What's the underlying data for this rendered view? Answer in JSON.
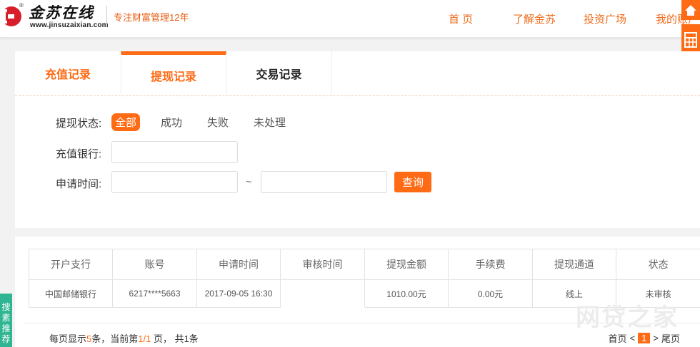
{
  "header": {
    "logo_text": "金苏在线",
    "logo_registered": "®",
    "logo_url": "www.jinsuzaixian.com",
    "slogan": "专注财富管理12年",
    "nav": [
      "首  页",
      "了解金苏",
      "投资广场",
      "我的账户"
    ]
  },
  "tabs": [
    "充值记录",
    "提现记录",
    "交易记录"
  ],
  "active_tab": "提现记录",
  "filters": {
    "status_label": "提现状态:",
    "status_options": [
      "全部",
      "成功",
      "失败",
      "未处理"
    ],
    "status_selected": "全部",
    "bank_label": "充值银行:",
    "bank_value": "",
    "time_label": "申请时间:",
    "time_from": "",
    "time_to": "",
    "range_sep": "~",
    "query_button": "查询"
  },
  "table": {
    "headers": [
      "开户支行",
      "账号",
      "申请时间",
      "审核时间",
      "提现金额",
      "手续费",
      "提现通道",
      "状态"
    ],
    "rows": [
      [
        "中国邮储银行",
        "6217****5663",
        "2017-09-05 16:30",
        "",
        "1010.00元",
        "0.00元",
        "线上",
        "未审核"
      ]
    ]
  },
  "pagination": {
    "info_prefix": "每页显示",
    "per_page": "5",
    "info_mid": "条，当前第",
    "current": "1/1",
    "info_suffix": " 页， 共1条",
    "first": "首页",
    "prev": "<",
    "page": "1",
    "next": ">",
    "last": "尾页"
  },
  "side_left": "搜素推荐",
  "watermark": "网贷之家",
  "colors": {
    "accent": "#ff6a14",
    "nav": "#ef6d1c",
    "side_left": "#2fb592"
  }
}
